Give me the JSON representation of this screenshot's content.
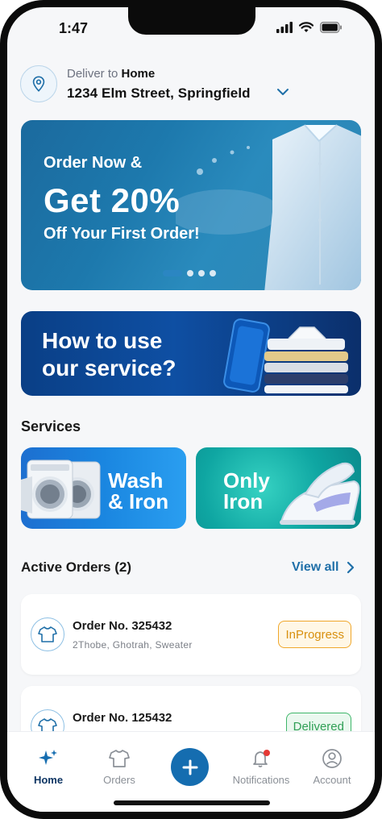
{
  "status": {
    "time": "1:47"
  },
  "delivery": {
    "label": "Deliver to",
    "place": "Home",
    "address": "1234 Elm Street, Springfield"
  },
  "promo": {
    "line1": "Order Now &",
    "line2": "Get 20%",
    "line3": "Off Your First Order!",
    "slide_count": 4,
    "active_slide": 1
  },
  "howto": {
    "line1": "How to use",
    "line2": "our service?"
  },
  "services": {
    "title": "Services",
    "items": [
      {
        "line1": "Wash",
        "line2": "& Iron"
      },
      {
        "line1": "Only",
        "line2": "Iron"
      }
    ]
  },
  "orders": {
    "title": "Active Orders (2)",
    "view_all": "View all",
    "items": [
      {
        "number": "Order No. 325432",
        "items": "2Thobe, Ghotrah, Sweater",
        "status": "InProgress",
        "status_color": "#d8900f"
      },
      {
        "number": "Order No. 125432",
        "items": "",
        "status": "Delivered",
        "status_color": "#2f9f55"
      }
    ]
  },
  "tabs": {
    "home": "Home",
    "orders": "Orders",
    "notifications": "Notifications",
    "account": "Account"
  },
  "colors": {
    "accent": "#156db0",
    "active_tab": "#0e3563",
    "notification_dot": "#e53935"
  }
}
